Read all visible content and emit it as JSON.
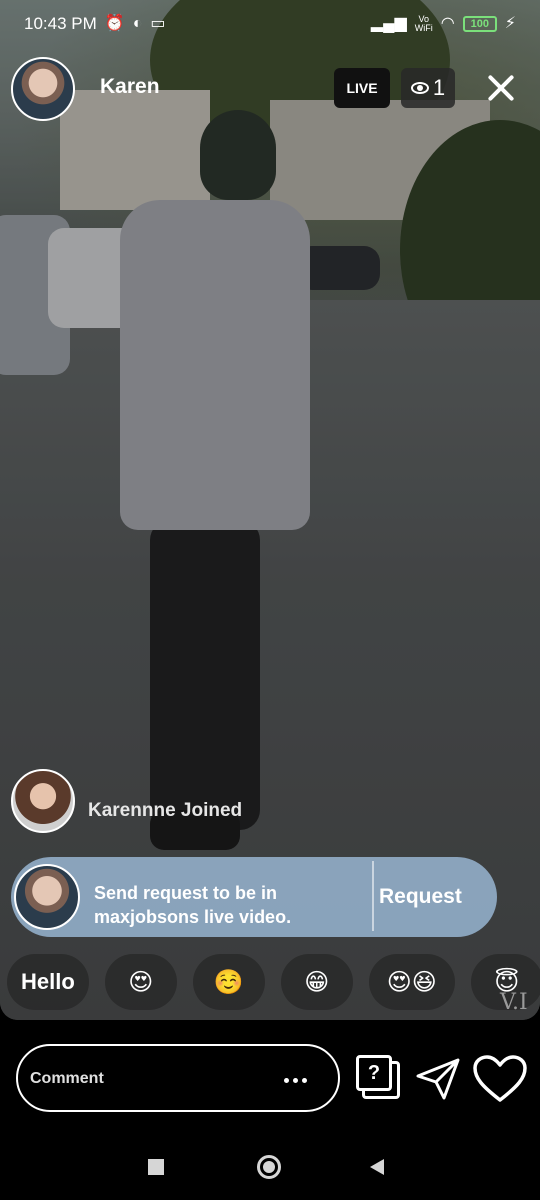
{
  "status_bar": {
    "time": "10:43 PM",
    "left_icons": [
      "alarm-icon",
      "pinwheel-app-icon",
      "laptop-icon"
    ],
    "network_label_top": "Vo",
    "network_label_bottom": "WiFi",
    "battery": "100",
    "charging_symbol": "⚡"
  },
  "live_header": {
    "host_name": "Karen",
    "live_label": "LIVE",
    "viewer_count": "1"
  },
  "join_notice": {
    "text": "Karennne Joined"
  },
  "request_banner": {
    "message": "Send request to be in maxjobsons live video.",
    "button_label": "Request",
    "color": "#9bb9d7"
  },
  "quick_replies": [
    "Hello",
    "😍",
    "☺️",
    "😁",
    "😍😆",
    "😇",
    "😇😊"
  ],
  "watermark": "V.I",
  "comment_bar": {
    "placeholder": "Comment",
    "question_glyph": "?"
  },
  "icons": {
    "close": "close-icon",
    "viewers": "eye-icon",
    "send": "send-icon",
    "like": "heart-icon",
    "more": "more-dots-icon",
    "question": "question-box-icon"
  },
  "colors": {
    "battery": "#7be07b",
    "live_badge_bg": "#111111"
  }
}
